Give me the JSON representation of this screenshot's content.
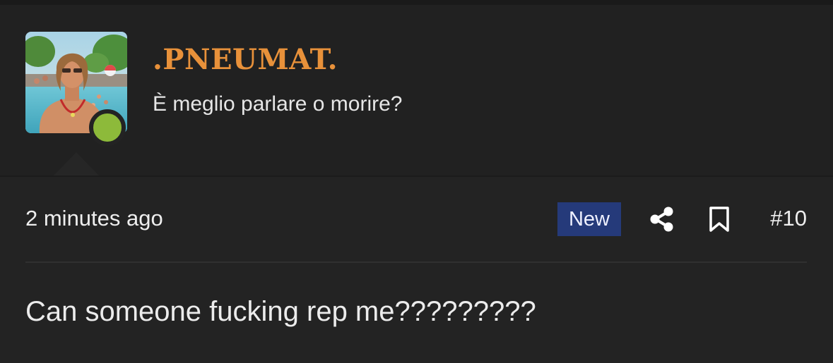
{
  "user": {
    "name": ".PNEUMAT.",
    "title": "È meglio parlare o morire?",
    "status": "online",
    "name_color": "#e8913a",
    "status_color": "#8dba3a"
  },
  "post": {
    "time": "2 minutes ago",
    "badge": "New",
    "badge_color": "#253a7a",
    "number": "#10",
    "message": "Can someone fucking rep me?????????",
    "share_icon": "share-icon",
    "bookmark_icon": "bookmark-icon"
  }
}
